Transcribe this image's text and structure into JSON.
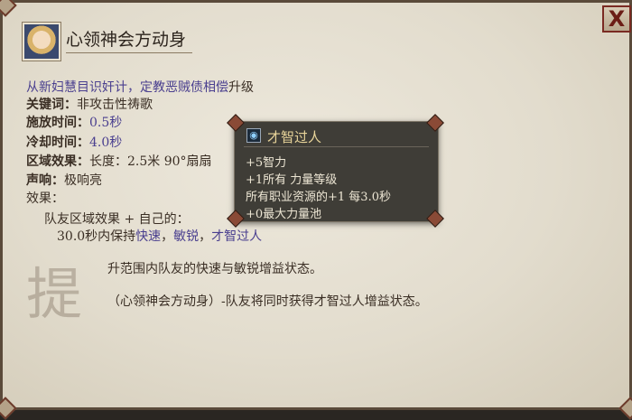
{
  "window": {
    "close_label": "X",
    "portrait_icon": "female-character-portrait"
  },
  "spell": {
    "title": "心领神会方动身",
    "summary_blue": "从新妇慧目识奸计，定教恶贼债相偿",
    "summary_black": "升级",
    "keyword_label": "关键词：",
    "keyword_value": "非攻击性祷歌",
    "cast_label": "施放时间：",
    "cast_value": "0.5秒",
    "cooldown_label": "冷却时间：",
    "cooldown_value": "4.0秒",
    "area_label": "区域效果：",
    "area_value": "长度：2.5米 90°扇扇",
    "sound_label": "声响：",
    "sound_value": "极响亮",
    "effect_label": "效果：",
    "effect_line1": "队友区域效果 + 自己的：",
    "effect_line2_prefix": "30.0秒内保持",
    "effect_link1": "快速",
    "effect_sep1": "，",
    "effect_link2": "敏锐",
    "effect_sep2": "，",
    "effect_link3": "才智过人",
    "watermark": "提",
    "desc1": "升范围内队友的快速与敏锐增益状态。",
    "desc2": "（心领神会方动身）-队友将同时获得才智过人增益状态。"
  },
  "tooltip": {
    "icon": "brain-icon",
    "title": "才智过人",
    "lines": [
      "+5智力",
      "+1所有 力量等级",
      "所有职业资源的+1 每3.0秒",
      "+0最大力量池"
    ]
  },
  "colors": {
    "link_blue": "#4a3f8f",
    "tooltip_title": "#e8d49a",
    "close_red": "#6b1d16"
  }
}
